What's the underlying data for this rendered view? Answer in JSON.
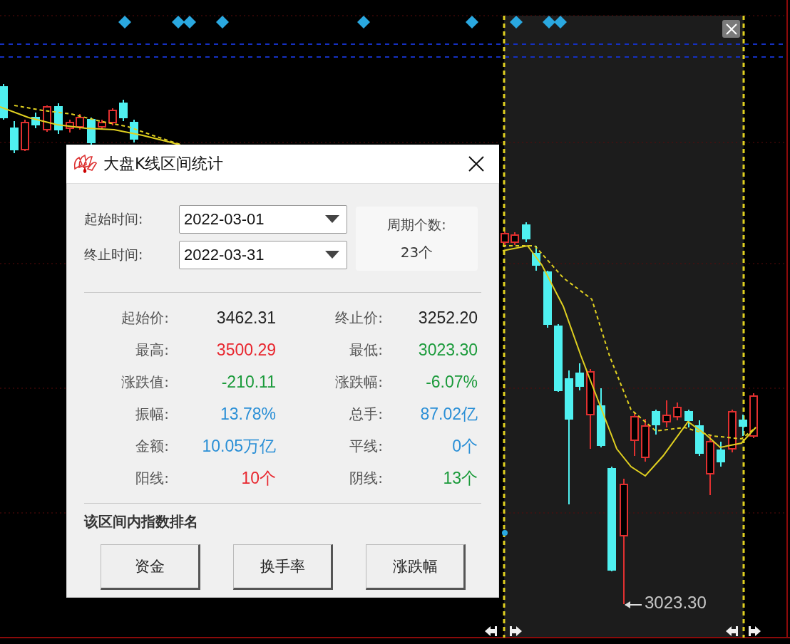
{
  "chart": {
    "low_label": "3023.30"
  },
  "dialog": {
    "title": "大盘K线区间统计",
    "start": {
      "label": "起始时间:",
      "value": "2022-03-01"
    },
    "end": {
      "label": "终止时间:",
      "value": "2022-03-31"
    },
    "period": {
      "label": "周期个数:",
      "value": "23个"
    },
    "stats": [
      {
        "label": "起始价:",
        "value": "3462.31",
        "color": "#222222"
      },
      {
        "label": "终止价:",
        "value": "3252.20",
        "color": "#222222"
      },
      {
        "label": "最高:",
        "value": "3500.29",
        "color": "#e8262e"
      },
      {
        "label": "最低:",
        "value": "3023.30",
        "color": "#1a9a3a"
      },
      {
        "label": "涨跌值:",
        "value": "-210.11",
        "color": "#1a9a3a"
      },
      {
        "label": "涨跌幅:",
        "value": "-6.07%",
        "color": "#1a9a3a"
      },
      {
        "label": "振幅:",
        "value": "13.78%",
        "color": "#2a8fd6"
      },
      {
        "label": "总手:",
        "value": "87.02亿",
        "color": "#2a8fd6"
      },
      {
        "label": "金额:",
        "value": "10.05万亿",
        "color": "#2a8fd6"
      },
      {
        "label": "平线:",
        "value": "0个",
        "color": "#2a8fd6"
      },
      {
        "label": "阳线:",
        "value": "10个",
        "color": "#e8262e"
      },
      {
        "label": "阴线:",
        "value": "13个",
        "color": "#1a9a3a"
      }
    ],
    "ranking": {
      "title": "该区间内指数排名",
      "buttons": [
        "资金",
        "换手率",
        "涨跌幅"
      ]
    }
  }
}
